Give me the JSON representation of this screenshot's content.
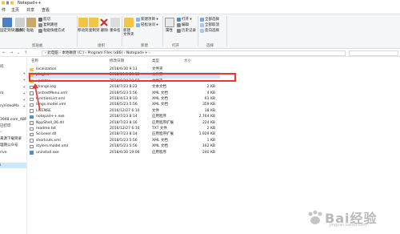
{
  "window": {
    "title": "Notepad++"
  },
  "tabs": [
    "件",
    "主页",
    "共享",
    "查看"
  ],
  "ribbon": {
    "clipboard": {
      "pin": "固定到快速访问",
      "copy": "复制",
      "paste": "粘贴",
      "cut": "剪切",
      "copy_path": "复制路径",
      "paste_shortcut": "粘贴快捷方式",
      "group": "剪贴板"
    },
    "organize": {
      "move_to": "移动到",
      "copy_to": "复制到",
      "delete": "删除",
      "rename": "重命名",
      "group": "组织"
    },
    "new": {
      "new_folder": "新建\n文件夹",
      "new_item": "新建项目 ▾",
      "easy_access": "轻松访问 ▾",
      "group": "新建"
    },
    "open": {
      "properties": "属性",
      "open": "打开 ▾",
      "edit": "编辑",
      "history": "历史记录",
      "group": "打开"
    },
    "select": {
      "select_all": "全部选择",
      "select_none": "全部取消",
      "invert": "反向选择",
      "group": "选择"
    }
  },
  "address": {
    "path": "› 此电脑 › 本地磁盘 (C:) › Program Files (x86) › Notepad++ ›"
  },
  "sidebar": {
    "items": [
      {
        "label": "问",
        "pinned": false
      },
      {
        "label": "",
        "pinned": true
      },
      {
        "label": "",
        "pinned": true
      },
      {
        "label": "",
        "pinned": true
      },
      {
        "label": "ro",
        "pinned": true
      },
      {
        "label": "",
        "pinned": true
      },
      {
        "label": "ryVideoMa",
        "pinned": true
      },
      {
        "label": "",
        "pinned": false
      },
      {
        "label": "3948.com_ABP",
        "pinned": false
      },
      {
        "label": "已打印",
        "pinned": false
      },
      {
        "label": "-",
        "pinned": false
      },
      {
        "label": "来源下载目录",
        "pinned": false
      },
      {
        "label": "理期公众号",
        "pinned": false
      },
      {
        "label": "rive",
        "pinned": false
      },
      {
        "label": "",
        "pinned": false
      },
      {
        "label": "i",
        "pinned": false,
        "selected": true
      }
    ]
  },
  "columns": {
    "name": "名称",
    "date": "修改日期",
    "type": "类型",
    "size": "大小"
  },
  "files": [
    {
      "name": "localization",
      "date": "2018/6/30 9:13",
      "type": "文件夹",
      "size": "",
      "icon": "folder"
    },
    {
      "name": "plugins",
      "date": "2018/10/8 23:12",
      "type": "文件夹",
      "size": "",
      "icon": "folder",
      "selected": true
    },
    {
      "name": "updater",
      "date": "2018/6/30 19:02",
      "type": "文件夹",
      "size": "",
      "icon": "folder"
    },
    {
      "name": "change.log",
      "date": "2018/7/23 8:22",
      "type": "文本文档",
      "size": "2 KB",
      "icon": "file"
    },
    {
      "name": "contextMenu.xml",
      "date": "2018/5/23 5:56",
      "type": "XML 文档",
      "size": "4 KB",
      "icon": "file"
    },
    {
      "name": "functionList.xml",
      "date": "2018/4/13 8:10",
      "type": "XML 文档",
      "size": "61 KB",
      "icon": "file"
    },
    {
      "name": "langs.model.xml",
      "date": "2018/5/23 5:56",
      "type": "XML 文档",
      "size": "359 KB",
      "icon": "file"
    },
    {
      "name": "LICENSE",
      "date": "2016/12/27 6:10",
      "type": "文件",
      "size": "18 KB",
      "icon": "file"
    },
    {
      "name": "notepad++.exe",
      "date": "2018/7/23 8:14",
      "type": "应用程序",
      "size": "2,764 KB",
      "icon": "exe"
    },
    {
      "name": "NppShell_06.dll",
      "date": "2018/7/23 8:16",
      "type": "应用程序扩展",
      "size": "224 KB",
      "icon": "dll"
    },
    {
      "name": "readme.txt",
      "date": "2016/12/27 6:10",
      "type": "TXT 文件",
      "size": "2 KB",
      "icon": "file"
    },
    {
      "name": "SciLexer.dll",
      "date": "2018/7/23 8:14",
      "type": "应用程序扩展",
      "size": "1,929 KB",
      "icon": "dll"
    },
    {
      "name": "shortcuts.xml",
      "date": "2018/5/23 5:56",
      "type": "XML 文档",
      "size": "1 KB",
      "icon": "file"
    },
    {
      "name": "stylers.model.xml",
      "date": "2018/5/23 5:56",
      "type": "XML 文档",
      "size": "162 KB",
      "icon": "file"
    },
    {
      "name": "uninstall.exe",
      "date": "2018/6/30 19:06",
      "type": "应用程序",
      "size": "240 KB",
      "icon": "exe"
    }
  ],
  "watermark": {
    "main": "Bai经验",
    "sub": "jingyan.baidu.com"
  }
}
